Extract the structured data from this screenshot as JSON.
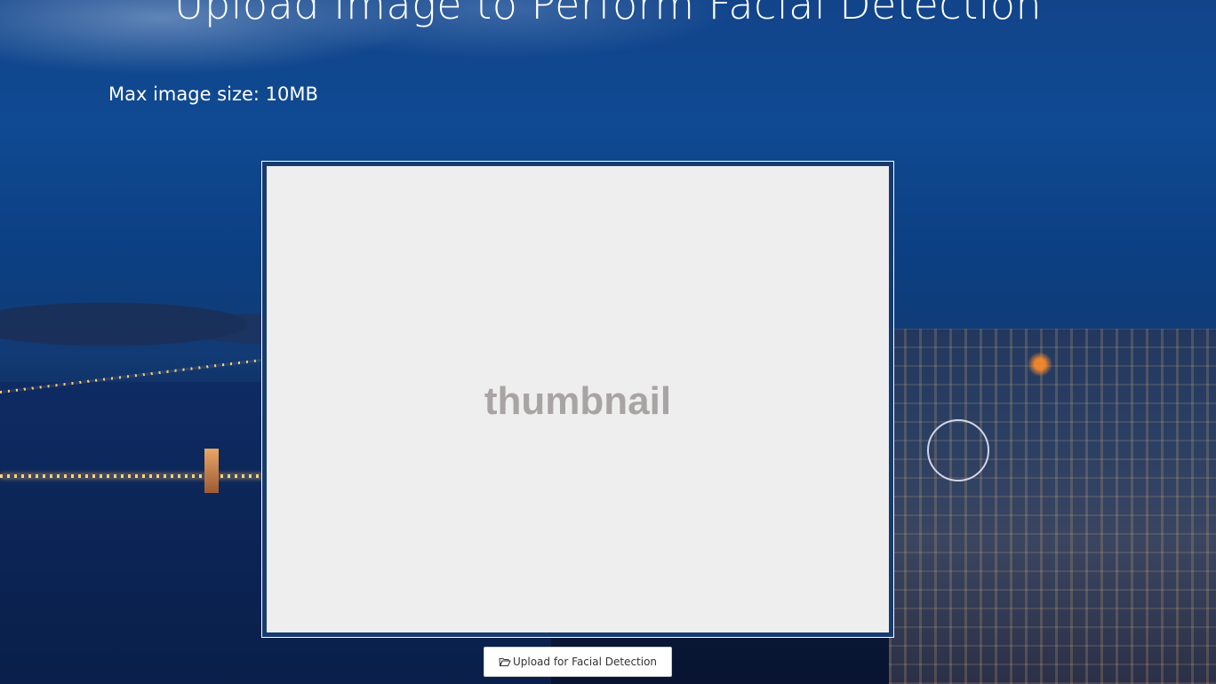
{
  "page": {
    "title": "Upload Image to Perform Facial Detection",
    "max_size_text": "Max image size: 10MB"
  },
  "thumbnail": {
    "placeholder_text": "thumbnail"
  },
  "upload_button": {
    "label": "Upload for Facial Detection",
    "icon": "folder-open-icon"
  },
  "colors": {
    "background_blue": "#0f4a92",
    "thumbnail_bg": "#eeeeee",
    "thumbnail_text": "#a8a4a3",
    "text_white": "#ffffff"
  }
}
